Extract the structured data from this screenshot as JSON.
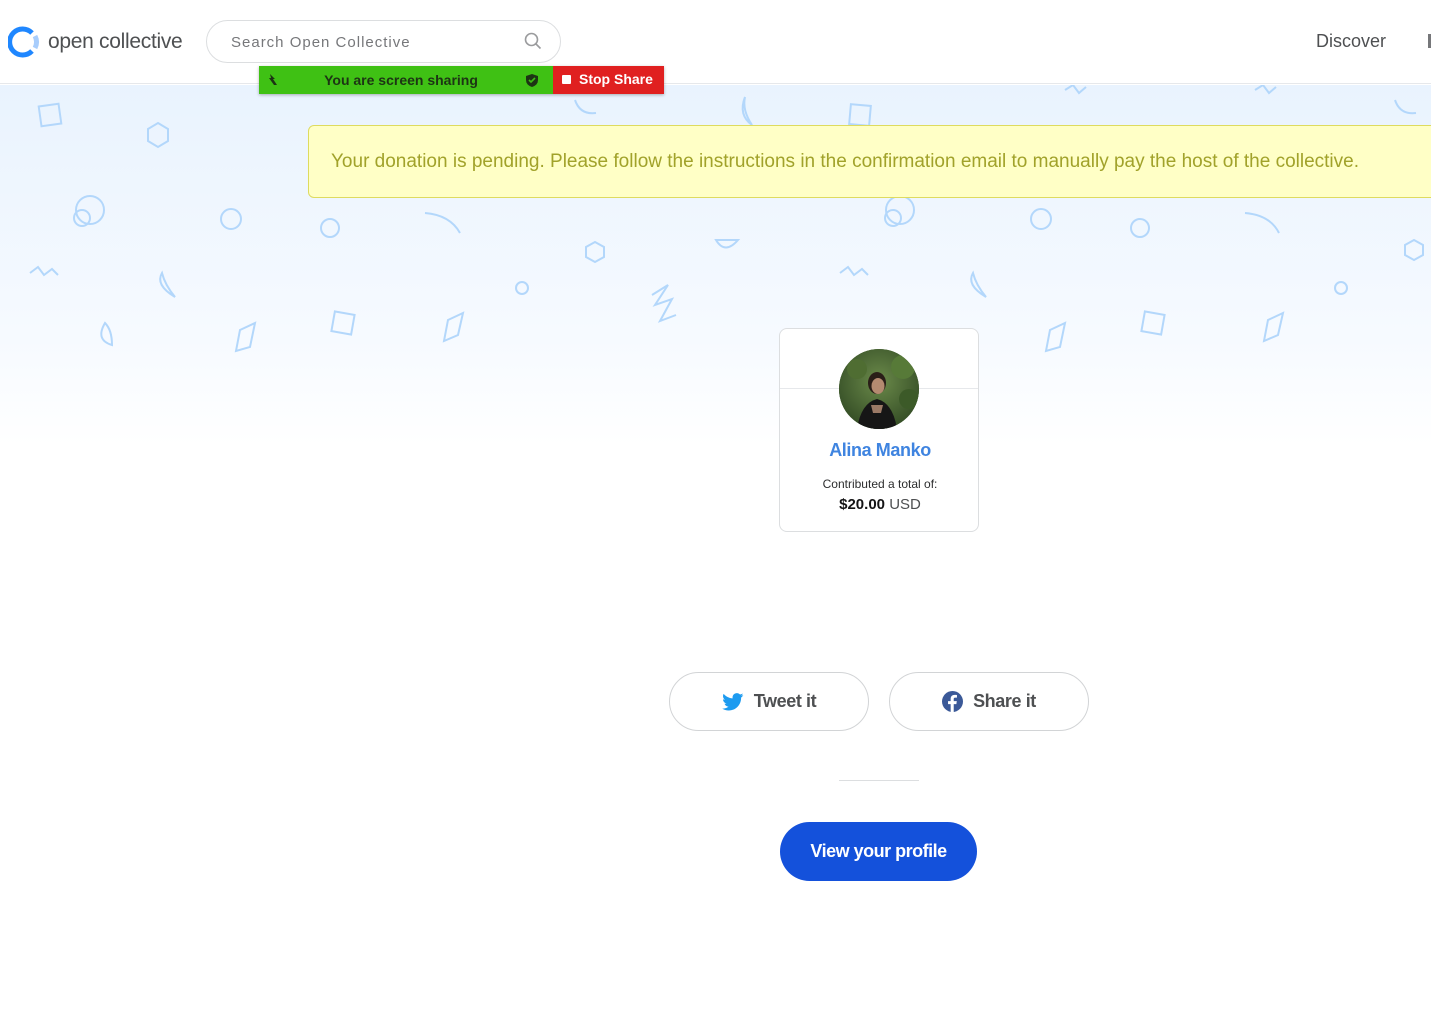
{
  "header": {
    "logo_text": "open collective",
    "search_placeholder": "Search Open Collective",
    "nav": {
      "discover": "Discover"
    }
  },
  "screen_share": {
    "status": "You are screen sharing",
    "stop_label": "Stop Share",
    "colors": {
      "bar": "#3fc114",
      "stop": "#e02020"
    }
  },
  "banner": {
    "message": "Your donation is pending. Please follow the instructions in the confirmation email to manually pay the host of the collective."
  },
  "contributor": {
    "name": "Alina Manko",
    "total_label": "Contributed a total of:",
    "amount": "$20.00",
    "currency": "USD"
  },
  "actions": {
    "tweet_label": "Tweet it",
    "share_label": "Share it",
    "profile_label": "View your profile"
  },
  "colors": {
    "accent": "#1451db",
    "name_link": "#3f84e0",
    "banner_bg": "#ffffc6",
    "banner_text": "#a1a22a"
  }
}
